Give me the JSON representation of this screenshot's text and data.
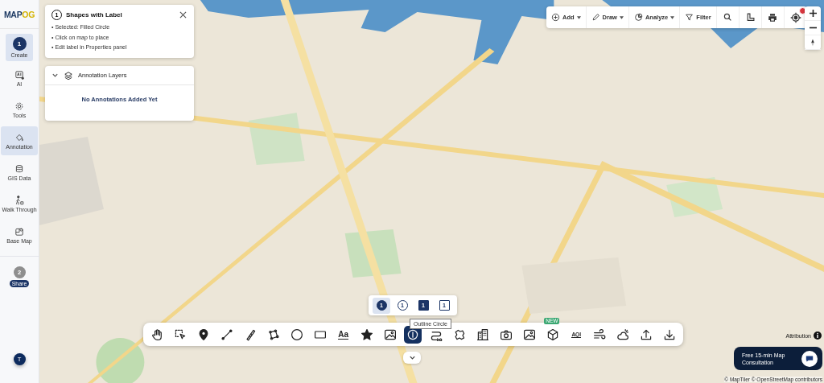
{
  "logo": {
    "main": "MAP",
    "accent": "OG"
  },
  "sidebar": {
    "items": [
      {
        "label": "Create",
        "kind": "step",
        "step": "1",
        "selected": true
      },
      {
        "label": "AI",
        "kind": "tool",
        "selected": false
      },
      {
        "label": "Tools",
        "kind": "tool",
        "selected": false
      },
      {
        "label": "Annotation",
        "kind": "tool",
        "selected": true
      },
      {
        "label": "GIS Data",
        "kind": "tool",
        "selected": false
      },
      {
        "label": "Walk Through",
        "kind": "tool",
        "selected": false
      },
      {
        "label": "Base Map",
        "kind": "tool",
        "selected": false
      }
    ],
    "share": {
      "step": "2",
      "label": "Share"
    },
    "avatar": "T"
  },
  "info_panel": {
    "step": "1",
    "title": "Shapes with Label",
    "lines": [
      "• Selected: Filled Circle",
      "• Click on map to place",
      "• Edit label in Properties panel"
    ]
  },
  "layers_panel": {
    "title": "Annotation Layers",
    "expanded": true,
    "empty_text": "No Annotations Added Yet"
  },
  "top_toolbar": {
    "buttons": [
      {
        "label": "Add",
        "dropdown": true
      },
      {
        "label": "Draw",
        "dropdown": true
      },
      {
        "label": "Analyze",
        "dropdown": true
      },
      {
        "label": "Filter",
        "dropdown": false
      }
    ],
    "locate_alert": true
  },
  "shape_options": [
    {
      "kind": "circle",
      "filled": true,
      "number": "1",
      "selected": true
    },
    {
      "kind": "circle",
      "filled": false,
      "number": "1",
      "selected": false
    },
    {
      "kind": "square",
      "filled": true,
      "number": "1",
      "selected": false
    },
    {
      "kind": "square",
      "filled": false,
      "number": "1",
      "selected": false
    }
  ],
  "tooltip": "Outline Circle",
  "tools": [
    {
      "selected": false
    },
    {
      "selected": false
    },
    {
      "selected": false
    },
    {
      "selected": false
    },
    {
      "selected": false
    },
    {
      "selected": false
    },
    {
      "selected": false
    },
    {
      "selected": false
    },
    {
      "selected": false,
      "caption": "Aa"
    },
    {
      "selected": false
    },
    {
      "selected": false
    },
    {
      "selected": true
    },
    {
      "selected": false
    },
    {
      "selected": false
    },
    {
      "selected": false
    },
    {
      "selected": false
    },
    {
      "selected": false
    },
    {
      "selected": false,
      "badge": "NEW"
    },
    {
      "selected": false,
      "caption": "AQI"
    },
    {
      "selected": false
    },
    {
      "selected": false
    },
    {
      "selected": false
    },
    {
      "selected": false
    }
  ],
  "attribution": "Attribution",
  "consult_button": "Free 15-min Map Consultation",
  "copyright": "© MapTiler © OpenStreetMap contributors"
}
